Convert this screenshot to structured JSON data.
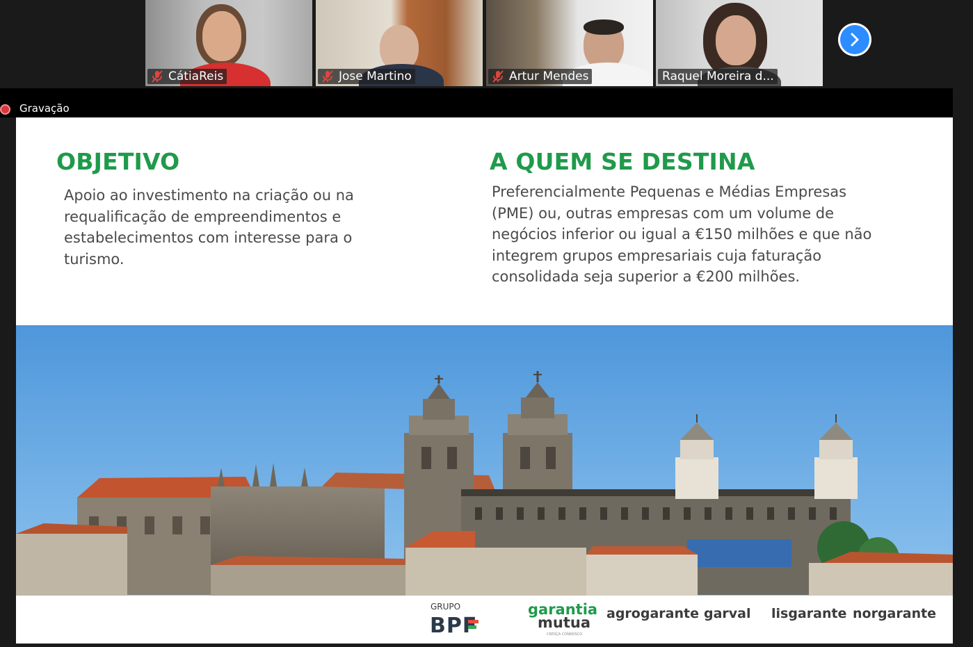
{
  "participants": [
    {
      "name": "CátiaReis",
      "muted": true
    },
    {
      "name": "Jose Martino",
      "muted": true
    },
    {
      "name": "Artur Mendes",
      "muted": true
    },
    {
      "name": "Raquel Moreira d...",
      "muted": false,
      "active_speaker": true
    }
  ],
  "recording": {
    "label": "Gravação"
  },
  "slide": {
    "left": {
      "heading": "OBJETIVO",
      "lines": [
        "Apoio ao investimento na criação ou na",
        "requalificação de empreendimentos e",
        "estabelecimentos com interesse para o",
        "turismo."
      ]
    },
    "right": {
      "heading": "A QUEM SE DESTINA",
      "lines": [
        "Preferencialmente Pequenas e Médias Empresas",
        "(PME) ou, outras empresas com um volume de",
        "negócios inferior ou igual a €150 milhões e que não",
        "integrem grupos empresariais cuja faturação",
        "consolidada seja superior a €200 milhões."
      ]
    },
    "logos": {
      "grupo": "GRUPO",
      "bpf": "BPF",
      "garantia_1": "garantia",
      "garantia_2": "mutua",
      "garantia_sub": "CRESÇA CONNOSCO",
      "agrogarante": "agrogarante",
      "garval": "garval",
      "lisgarante": "lisgarante",
      "norgarante": "norgarante"
    }
  },
  "colors": {
    "accent_green": "#1f9a4b",
    "body_text": "#4a4a4a",
    "active_border": "#8fd053",
    "next_button": "#2d8cff",
    "recording_red": "#d7373f"
  },
  "icons": [
    "muted-mic-icon",
    "chevron-right-icon",
    "recording-icon"
  ]
}
